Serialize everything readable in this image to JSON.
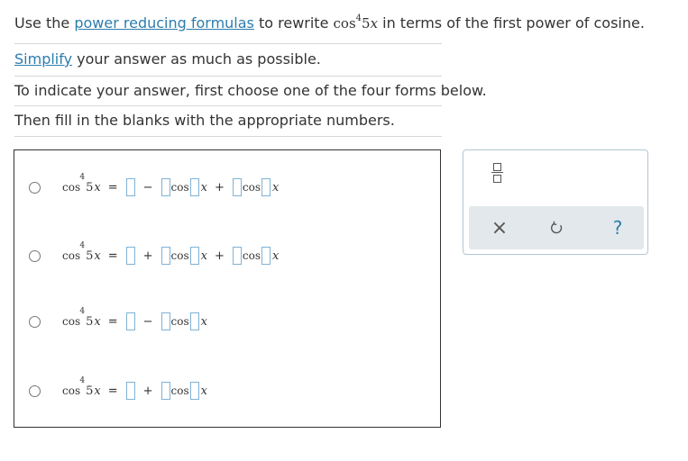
{
  "instructions": {
    "line1": {
      "prefix": "Use the ",
      "link": "power reducing formulas",
      "mid": " to rewrite ",
      "func": "cos",
      "exp": "4",
      "arg": "5",
      "var": "x",
      "suffix": " in terms of the first power of cosine."
    },
    "line2": {
      "link": "Simplify",
      "suffix": " your answer as much as possible."
    },
    "line3": "To indicate your answer, first choose one of the four forms below.",
    "line4": "Then fill in the blanks with the appropriate numbers."
  },
  "options": [
    {
      "lhs_func": "cos",
      "lhs_exp": "4",
      "lhs_arg": "5",
      "lhs_var": "x",
      "eq": "=",
      "op1": "−",
      "cos1": "cos",
      "var1": "x",
      "op2": "+",
      "cos2": "cos",
      "var2": "x"
    },
    {
      "lhs_func": "cos",
      "lhs_exp": "4",
      "lhs_arg": "5",
      "lhs_var": "x",
      "eq": "=",
      "op1": "+",
      "cos1": "cos",
      "var1": "x",
      "op2": "+",
      "cos2": "cos",
      "var2": "x"
    },
    {
      "lhs_func": "cos",
      "lhs_exp": "4",
      "lhs_arg": "5",
      "lhs_var": "x",
      "eq": "=",
      "op1": "−",
      "cos1": "cos",
      "var1": "x"
    },
    {
      "lhs_func": "cos",
      "lhs_exp": "4",
      "lhs_arg": "5",
      "lhs_var": "x",
      "eq": "=",
      "op1": "+",
      "cos1": "cos",
      "var1": "x"
    }
  ],
  "toolbar": {
    "fraction_icon": "fraction-icon",
    "clear_icon": "close-icon",
    "undo_icon": "undo-icon",
    "help_icon": "help-icon",
    "clear_glyph": "×",
    "help_glyph": "?"
  },
  "colors": {
    "link": "#2c7dad",
    "blank_border": "#7fb2d6",
    "toolbar_bg": "#e3e8ec"
  }
}
